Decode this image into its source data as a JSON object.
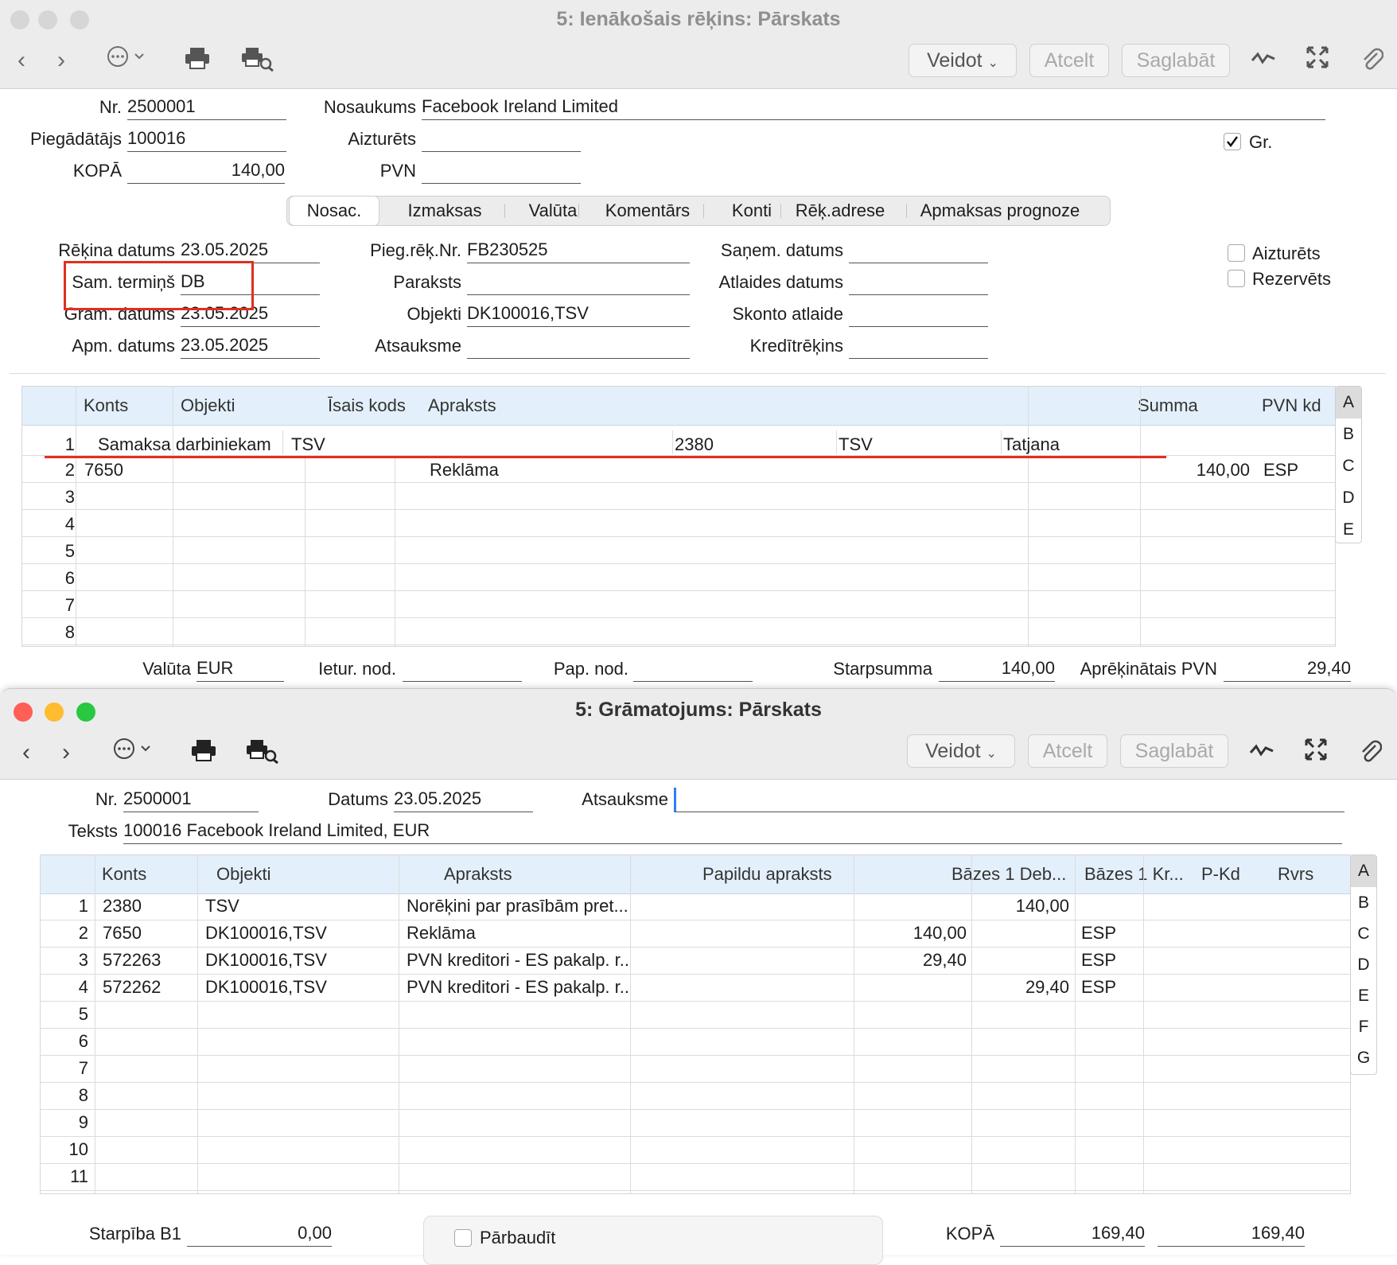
{
  "invoice_window": {
    "title": "5: Ienākošais rēķins: Pārskats",
    "toolbar": {
      "create": "Veidot",
      "cancel": "Atcelt",
      "save": "Saglabāt"
    },
    "header": {
      "nr_label": "Nr.",
      "nr": "2500001",
      "name_label": "Nosaukums",
      "name": "Facebook Ireland Limited",
      "supplier_label": "Piegādātājs",
      "supplier": "100016",
      "held_label": "Aizturēts",
      "held": "",
      "total_label": "KOPĀ",
      "total": "140,00",
      "vat_label": "PVN",
      "vat": "",
      "gr_label": "Gr.",
      "gr_checked": true
    },
    "tabs": [
      "Nosac.",
      "Izmaksas",
      "Valūta",
      "Komentārs",
      "Konti",
      "Rēķ.adrese",
      "Apmaksas prognoze"
    ],
    "conditions": {
      "invoice_date_label": "Rēķina datums",
      "invoice_date": "23.05.2025",
      "pay_term_label": "Sam. termiņš",
      "pay_term": "DB",
      "book_date_label": "Grām. datums",
      "book_date": "23.05.2025",
      "pay_date_label": "Apm. datums",
      "pay_date": "23.05.2025",
      "supp_inv_label": "Pieg.rēķ.Nr.",
      "supp_inv": "FB230525",
      "signature_label": "Paraksts",
      "signature": "",
      "objects_label": "Objekti",
      "objects": "DK100016,TSV",
      "reference_label": "Atsauksme",
      "reference": "",
      "received_label": "Saņem. datums",
      "received": "",
      "discount_date_label": "Atlaides datums",
      "discount_date": "",
      "skonto_label": "Skonto atlaide",
      "skonto": "",
      "credit_label": "Kredītrēķins",
      "credit": "",
      "held_label": "Aizturēts",
      "reserved_label": "Rezervēts"
    },
    "grid": {
      "columns": [
        "Konts",
        "Objekti",
        "Īsais kods",
        "Apraksts",
        "Summa",
        "PVN kd"
      ],
      "row1_subcells": [
        "Samaksa darbiniekam",
        "TSV",
        "2380",
        "TSV",
        "Tatjana"
      ],
      "rows": [
        {
          "n": "1",
          "account": "",
          "objects": "",
          "short": "",
          "desc": "",
          "sum": "",
          "vat": ""
        },
        {
          "n": "2",
          "account": "7650",
          "objects": "",
          "short": "",
          "desc": "Reklāma",
          "sum": "140,00",
          "vat": "ESP"
        },
        {
          "n": "3",
          "account": "",
          "objects": "",
          "short": "",
          "desc": "",
          "sum": "",
          "vat": ""
        },
        {
          "n": "4",
          "account": "",
          "objects": "",
          "short": "",
          "desc": "",
          "sum": "",
          "vat": ""
        },
        {
          "n": "5",
          "account": "",
          "objects": "",
          "short": "",
          "desc": "",
          "sum": "",
          "vat": ""
        },
        {
          "n": "6",
          "account": "",
          "objects": "",
          "short": "",
          "desc": "",
          "sum": "",
          "vat": ""
        },
        {
          "n": "7",
          "account": "",
          "objects": "",
          "short": "",
          "desc": "",
          "sum": "",
          "vat": ""
        },
        {
          "n": "8",
          "account": "",
          "objects": "",
          "short": "",
          "desc": "",
          "sum": "",
          "vat": ""
        }
      ],
      "letters": [
        "A",
        "B",
        "C",
        "D",
        "E"
      ]
    },
    "footer": {
      "currency_label": "Valūta",
      "currency": "EUR",
      "ietur_label": "Ietur. nod.",
      "ietur": "",
      "pap_label": "Pap. nod.",
      "pap": "",
      "subtotal_label": "Starpsumma",
      "subtotal": "140,00",
      "calc_vat_label": "Aprēķinātais PVN",
      "calc_vat": "29,40"
    }
  },
  "posting_window": {
    "title": "5: Grāmatojums: Pārskats",
    "toolbar": {
      "create": "Veidot",
      "cancel": "Atcelt",
      "save": "Saglabāt"
    },
    "header": {
      "nr_label": "Nr.",
      "nr": "2500001",
      "date_label": "Datums",
      "date": "23.05.2025",
      "reference_label": "Atsauksme",
      "reference": "",
      "text_label": "Teksts",
      "text": "100016 Facebook Ireland Limited, EUR"
    },
    "grid": {
      "columns": [
        "Konts",
        "Objekti",
        "Apraksts",
        "Papildu apraksts",
        "Bāzes 1 Deb...",
        "Bāzes 1 Kr...",
        "P-Kd",
        "Rvrs"
      ],
      "rows": [
        {
          "n": "1",
          "account": "2380",
          "objects": "TSV",
          "desc": "Norēķini par prasībām pret...",
          "extra": "",
          "debit": "",
          "credit": "140,00",
          "pkd": "",
          "rvrs": ""
        },
        {
          "n": "2",
          "account": "7650",
          "objects": "DK100016,TSV",
          "desc": "Reklāma",
          "extra": "",
          "debit": "140,00",
          "credit": "",
          "pkd": "ESP",
          "rvrs": ""
        },
        {
          "n": "3",
          "account": "572263",
          "objects": "DK100016,TSV",
          "desc": "PVN kreditori - ES pakalp. r...",
          "extra": "",
          "debit": "29,40",
          "credit": "",
          "pkd": "ESP",
          "rvrs": ""
        },
        {
          "n": "4",
          "account": "572262",
          "objects": "DK100016,TSV",
          "desc": "PVN kreditori - ES pakalp. r...",
          "extra": "",
          "debit": "",
          "credit": "29,40",
          "pkd": "ESP",
          "rvrs": ""
        },
        {
          "n": "5",
          "account": "",
          "objects": "",
          "desc": "",
          "extra": "",
          "debit": "",
          "credit": "",
          "pkd": "",
          "rvrs": ""
        },
        {
          "n": "6",
          "account": "",
          "objects": "",
          "desc": "",
          "extra": "",
          "debit": "",
          "credit": "",
          "pkd": "",
          "rvrs": ""
        },
        {
          "n": "7",
          "account": "",
          "objects": "",
          "desc": "",
          "extra": "",
          "debit": "",
          "credit": "",
          "pkd": "",
          "rvrs": ""
        },
        {
          "n": "8",
          "account": "",
          "objects": "",
          "desc": "",
          "extra": "",
          "debit": "",
          "credit": "",
          "pkd": "",
          "rvrs": ""
        },
        {
          "n": "9",
          "account": "",
          "objects": "",
          "desc": "",
          "extra": "",
          "debit": "",
          "credit": "",
          "pkd": "",
          "rvrs": ""
        },
        {
          "n": "10",
          "account": "",
          "objects": "",
          "desc": "",
          "extra": "",
          "debit": "",
          "credit": "",
          "pkd": "",
          "rvrs": ""
        },
        {
          "n": "11",
          "account": "",
          "objects": "",
          "desc": "",
          "extra": "",
          "debit": "",
          "credit": "",
          "pkd": "",
          "rvrs": ""
        }
      ],
      "letters": [
        "A",
        "B",
        "C",
        "D",
        "E",
        "F",
        "G"
      ]
    },
    "footer": {
      "diff_label": "Starpība B1",
      "diff": "0,00",
      "check_label": "Pārbaudīt",
      "total_label": "KOPĀ",
      "total_debit": "169,40",
      "total_credit": "169,40"
    }
  },
  "colors": {
    "highlight_red": "#e0301e",
    "grid_header": "#e3f0fb",
    "traffic_close": "#fe5f57",
    "traffic_min": "#febc2e",
    "traffic_max": "#28c840"
  },
  "icons": [
    "chevron-left-icon",
    "chevron-right-icon",
    "more-menu-icon",
    "print-icon",
    "print-preview-icon",
    "activity-icon",
    "fullscreen-icon",
    "paperclip-icon"
  ]
}
